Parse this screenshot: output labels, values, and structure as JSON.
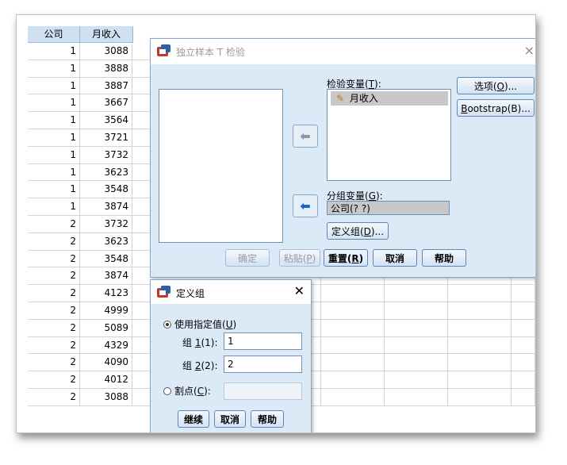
{
  "grid": {
    "columns": [
      "公司",
      "月收入"
    ],
    "rows": [
      [
        "1",
        "3088"
      ],
      [
        "1",
        "3888"
      ],
      [
        "1",
        "3887"
      ],
      [
        "1",
        "3667"
      ],
      [
        "1",
        "3564"
      ],
      [
        "1",
        "3721"
      ],
      [
        "1",
        "3732"
      ],
      [
        "1",
        "3623"
      ],
      [
        "1",
        "3548"
      ],
      [
        "1",
        "3874"
      ],
      [
        "2",
        "3732"
      ],
      [
        "2",
        "3623"
      ],
      [
        "2",
        "3548"
      ],
      [
        "2",
        "3874"
      ],
      [
        "2",
        "4123"
      ],
      [
        "2",
        "4999"
      ],
      [
        "2",
        "5089"
      ],
      [
        "2",
        "4329"
      ],
      [
        "2",
        "4090"
      ],
      [
        "2",
        "4012"
      ],
      [
        "2",
        "3088"
      ]
    ]
  },
  "main_dialog": {
    "title": "独立样本 T 检验",
    "close_icon": "×",
    "test_var_label_prefix": "检验变量(",
    "test_var_label_key": "T",
    "test_var_label_suffix": "):",
    "test_var_item": "月收入",
    "group_var_label_prefix": "分组变量(",
    "group_var_label_key": "G",
    "group_var_label_suffix": "):",
    "group_var_value": "公司(? ?)",
    "define_groups_prefix": "定义组(",
    "define_groups_key": "D",
    "define_groups_suffix": ")...",
    "options_prefix": "选项(",
    "options_key": "O",
    "options_suffix": ")...",
    "bootstrap_key": "B",
    "bootstrap_rest": "ootstrap(B)...",
    "ok": "确定",
    "paste_prefix": "粘贴(",
    "paste_key": "P",
    "paste_suffix": ")",
    "reset_prefix": "重置(",
    "reset_key": "R",
    "reset_suffix": ")",
    "cancel": "取消",
    "help": "帮助"
  },
  "define_dialog": {
    "title": "定义组",
    "close_icon": "✕",
    "use_values_prefix": "使用指定值(",
    "use_values_key": "U",
    "use_values_suffix": ")",
    "group1_prefix": "组 ",
    "group1_key": "1",
    "group1_suffix": "(1):",
    "group1_value": "1",
    "group2_prefix": "组 ",
    "group2_key": "2",
    "group2_suffix": "(2):",
    "group2_value": "2",
    "cutpoint_prefix": "割点(",
    "cutpoint_key": "C",
    "cutpoint_suffix": "):",
    "continue": "继续",
    "cancel": "取消",
    "help": "帮助"
  },
  "icons": {
    "app": "spss-dialog-icon",
    "variable": "pencil-icon",
    "arrow": "arrow-left-icon"
  },
  "colors": {
    "dialog_bg": "#dce9f6",
    "header_bg": "#cfe0f3",
    "arrow_active": "#1b66c9"
  }
}
